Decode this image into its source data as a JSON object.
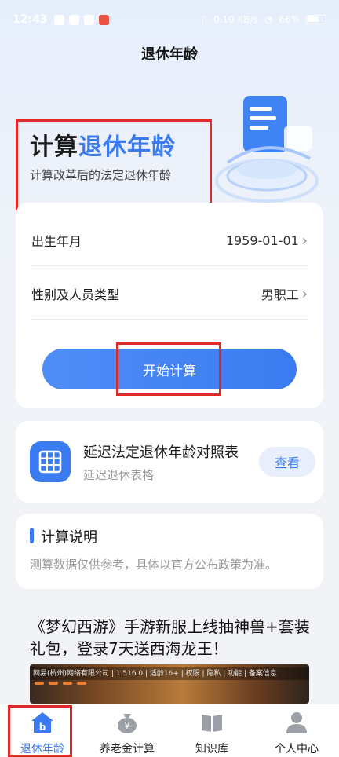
{
  "status_bar": {
    "time": "12:43",
    "net_speed": "0.10 KB/s",
    "battery": "66%"
  },
  "navbar": {
    "title": "退休年龄"
  },
  "hero": {
    "title_prefix": "计算",
    "title_highlight": "退休年龄",
    "subtitle": "计算改革后的法定退休年龄"
  },
  "form": {
    "birth_label": "出生年月",
    "birth_value": "1959-01-01",
    "type_label": "性别及人员类型",
    "type_value": "男职工",
    "start_button": "开始计算"
  },
  "table_card": {
    "title": "延迟法定退休年龄对照表",
    "subtitle": "延迟退休表格",
    "view_button": "查看"
  },
  "note_card": {
    "title": "计算说明",
    "text": "测算数据仅供参考，具体以官方公布政策为准。"
  },
  "ad": {
    "title": "《梦幻西游》手游新服上线抽神兽+套装礼包，登录7天送西海龙王！",
    "info_strip": "网易(杭州)网络有限公司 | 1.516.0 | 适龄16+ | 权限 | 隐私 | 功能 | 备案信息"
  },
  "tabbar": {
    "items": [
      {
        "label": "退休年龄",
        "icon": "retire-age-icon",
        "active": true
      },
      {
        "label": "养老金计算",
        "icon": "money-bag-icon",
        "active": false
      },
      {
        "label": "知识库",
        "icon": "book-icon",
        "active": false
      },
      {
        "label": "个人中心",
        "icon": "user-icon",
        "active": false
      }
    ]
  },
  "colors": {
    "accent": "#3a7bf0",
    "highlight_box": "#e02a2a"
  }
}
